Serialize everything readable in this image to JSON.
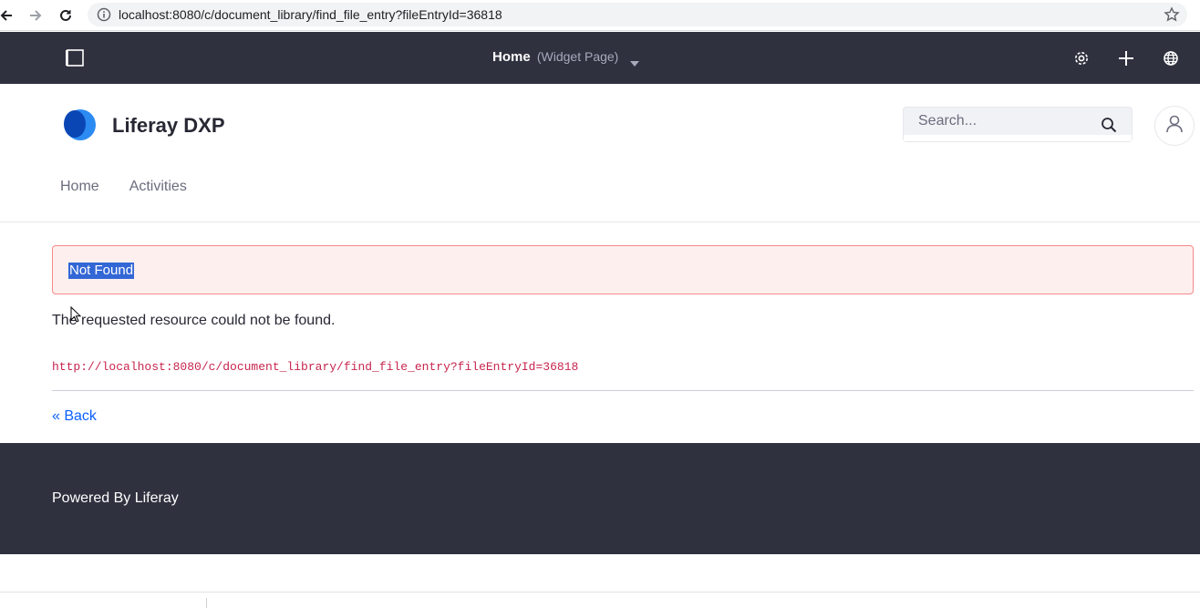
{
  "browser": {
    "url": "localhost:8080/c/document_library/find_file_entry?fileEntryId=36818"
  },
  "control_menu": {
    "page_title": "Home",
    "page_type": "(Widget Page)"
  },
  "header": {
    "site_name": "Liferay DXP",
    "search": {
      "placeholder": "Search...",
      "value": ""
    }
  },
  "nav": {
    "items": [
      {
        "label": "Home"
      },
      {
        "label": "Activities"
      }
    ]
  },
  "error": {
    "alert_label": "Not Found",
    "message": "The requested resource could not be found.",
    "url": "http://localhost:8080/c/document_library/find_file_entry?fileEntryId=36818",
    "back_label": "« Back"
  },
  "footer": {
    "text": "Powered By Liferay"
  },
  "colors": {
    "control_menu_bg": "#30313f",
    "alert_bg": "#feefef",
    "alert_border": "#f48989",
    "link": "#0b5fff",
    "code": "#c7254e"
  }
}
